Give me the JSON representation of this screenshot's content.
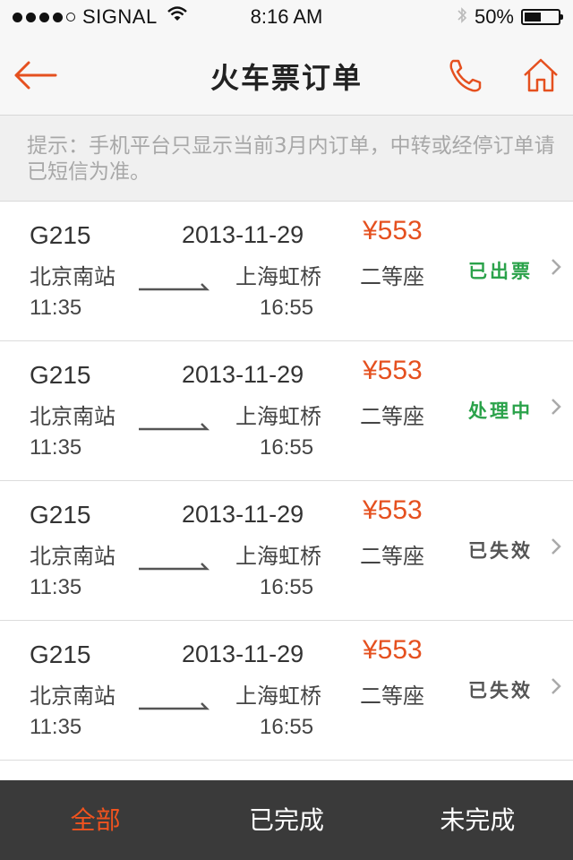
{
  "status_bar": {
    "carrier": "SIGNAL",
    "time": "8:16 AM",
    "battery": "50%",
    "battery_level": 0.5
  },
  "navbar": {
    "title": "火车票订单",
    "back_icon": "back-arrow-icon",
    "phone_icon": "phone-icon",
    "home_icon": "home-icon",
    "accent": "#e5501f"
  },
  "notice": {
    "text": "提示：手机平台只显示当前3月内订单，中转或经停订单请已短信为准。"
  },
  "orders": [
    {
      "train": "G215",
      "date": "2013-11-29",
      "price": "¥553",
      "from": "北京南站",
      "to": "上海虹桥",
      "seat": "二等座",
      "depart": "11:35",
      "arrive": "16:55",
      "status": "已出票",
      "status_color": "#2aa24a"
    },
    {
      "train": "G215",
      "date": "2013-11-29",
      "price": "¥553",
      "from": "北京南站",
      "to": "上海虹桥",
      "seat": "二等座",
      "depart": "11:35",
      "arrive": "16:55",
      "status": "处理中",
      "status_color": "#2aa24a"
    },
    {
      "train": "G215",
      "date": "2013-11-29",
      "price": "¥553",
      "from": "北京南站",
      "to": "上海虹桥",
      "seat": "二等座",
      "depart": "11:35",
      "arrive": "16:55",
      "status": "已失效",
      "status_color": "#555555"
    },
    {
      "train": "G215",
      "date": "2013-11-29",
      "price": "¥553",
      "from": "北京南站",
      "to": "上海虹桥",
      "seat": "二等座",
      "depart": "11:35",
      "arrive": "16:55",
      "status": "已失效",
      "status_color": "#555555"
    }
  ],
  "tabs": [
    {
      "label": "全部",
      "active": true
    },
    {
      "label": "已完成",
      "active": false
    },
    {
      "label": "未完成",
      "active": false
    }
  ]
}
